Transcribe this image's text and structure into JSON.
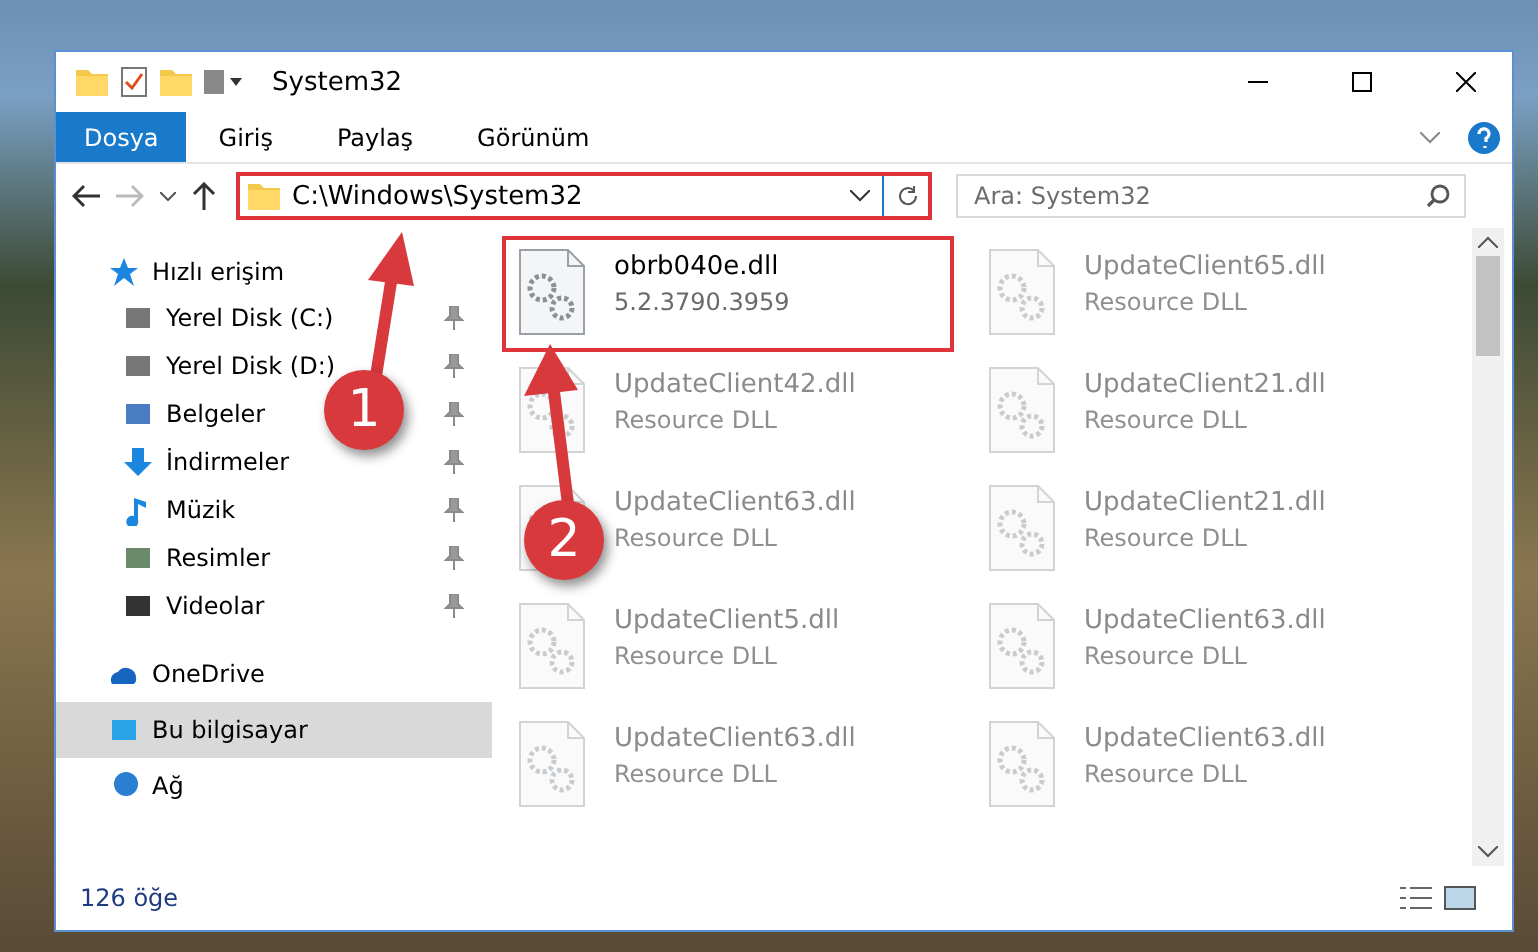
{
  "window": {
    "title": "System32"
  },
  "ribbon_tabs": [
    {
      "label": "Dosya",
      "selected": true
    },
    {
      "label": "Giriş",
      "selected": false
    },
    {
      "label": "Paylaş",
      "selected": false
    },
    {
      "label": "Görünüm",
      "selected": false
    }
  ],
  "address_bar": {
    "value": "C:\\Windows\\System32",
    "highlighted": true
  },
  "search": {
    "placeholder": "Ara: System32"
  },
  "navigation": [
    {
      "label": "Hızlı erişim",
      "selected": false,
      "children": [
        {
          "label": "Yerel Disk (C:)",
          "pinned": true,
          "selected": false
        },
        {
          "label": "Yerel Disk (D:)",
          "pinned": true,
          "selected": false
        },
        {
          "label": "Belgeler",
          "pinned": true,
          "selected": false
        },
        {
          "label": "İndirmeler",
          "pinned": true,
          "selected": false
        },
        {
          "label": "Müzik",
          "pinned": true,
          "selected": false
        },
        {
          "label": "Resimler",
          "pinned": true,
          "selected": false
        },
        {
          "label": "Videolar",
          "pinned": true,
          "selected": false
        }
      ]
    },
    {
      "label": "OneDrive",
      "selected": false
    },
    {
      "label": "Bu bilgisayar",
      "selected": true
    },
    {
      "label": "Ağ",
      "selected": false
    }
  ],
  "files": [
    {
      "name": "obrb040e.dll",
      "detail": "5.2.3790.3959",
      "faded": false,
      "highlighted": true
    },
    {
      "name": "UpdateClient65.dll",
      "detail": "Resource DLL",
      "faded": true,
      "highlighted": false
    },
    {
      "name": "UpdateClient42.dll",
      "detail": "Resource DLL",
      "faded": true,
      "highlighted": false
    },
    {
      "name": "UpdateClient21.dll",
      "detail": "Resource DLL",
      "faded": true,
      "highlighted": false
    },
    {
      "name": "UpdateClient63.dll",
      "detail": "Resource DLL",
      "faded": true,
      "highlighted": false
    },
    {
      "name": "UpdateClient21.dll",
      "detail": "Resource DLL",
      "faded": true,
      "highlighted": false
    },
    {
      "name": "UpdateClient5.dll",
      "detail": "Resource DLL",
      "faded": true,
      "highlighted": false
    },
    {
      "name": "UpdateClient63.dll",
      "detail": "Resource DLL",
      "faded": true,
      "highlighted": false
    },
    {
      "name": "UpdateClient63.dll",
      "detail": "Resource DLL",
      "faded": true,
      "highlighted": false
    },
    {
      "name": "UpdateClient63.dll",
      "detail": "Resource DLL",
      "faded": true,
      "highlighted": false
    }
  ],
  "status_bar": {
    "count": "126 öğe"
  },
  "callouts": [
    {
      "number": "1"
    },
    {
      "number": "2"
    }
  ]
}
